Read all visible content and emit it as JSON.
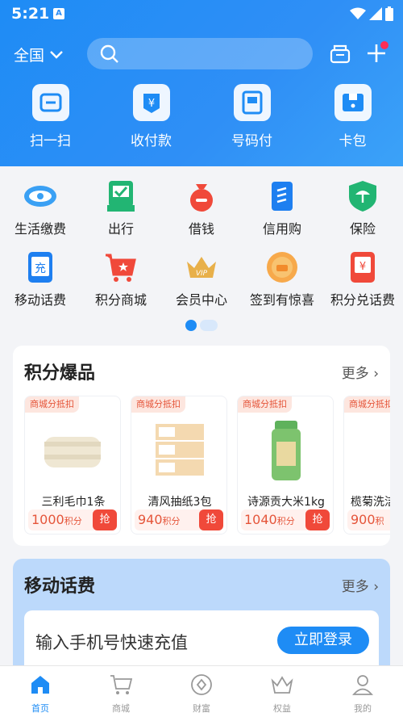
{
  "status_bar": {
    "time": "5:21",
    "notification_letter": "A"
  },
  "header": {
    "region": "全国",
    "search_placeholder": ""
  },
  "quick_actions": [
    {
      "label": "扫一扫",
      "icon": "scan-icon"
    },
    {
      "label": "收付款",
      "icon": "payment-icon"
    },
    {
      "label": "号码付",
      "icon": "phone-pay-icon"
    },
    {
      "label": "卡包",
      "icon": "card-wallet-icon"
    }
  ],
  "services": [
    {
      "label": "生活缴费",
      "icon": "utility-bill-icon"
    },
    {
      "label": "出行",
      "icon": "travel-icon"
    },
    {
      "label": "借钱",
      "icon": "loan-icon"
    },
    {
      "label": "信用购",
      "icon": "credit-shop-icon"
    },
    {
      "label": "保险",
      "icon": "insurance-icon"
    },
    {
      "label": "移动话费",
      "icon": "mobile-recharge-icon"
    },
    {
      "label": "积分商城",
      "icon": "points-mall-icon"
    },
    {
      "label": "会员中心",
      "icon": "vip-icon"
    },
    {
      "label": "签到有惊喜",
      "icon": "checkin-icon"
    },
    {
      "label": "积分兑话费",
      "icon": "points-exchange-icon"
    }
  ],
  "hot_points": {
    "title": "积分爆品",
    "more": "更多",
    "products": [
      {
        "tag": "商城分抵扣",
        "name": "三利毛巾1条",
        "points": "1000",
        "unit": "积分",
        "action": "抢"
      },
      {
        "tag": "商城分抵扣",
        "name": "清风抽纸3包",
        "points": "940",
        "unit": "积分",
        "action": "抢"
      },
      {
        "tag": "商城分抵扣",
        "name": "诗源贡大米1kg",
        "points": "1040",
        "unit": "积分",
        "action": "抢"
      },
      {
        "tag": "商城分抵扣",
        "name": "榄菊洗洁",
        "points": "900",
        "unit": "积",
        "action": ""
      }
    ]
  },
  "mobile_fee": {
    "title": "移动话费",
    "more": "更多",
    "input_prompt": "输入手机号快速充值",
    "login_button": "立即登录"
  },
  "tabs": [
    {
      "label": "首页",
      "icon": "home-icon",
      "active": true
    },
    {
      "label": "商城",
      "icon": "mall-icon",
      "active": false
    },
    {
      "label": "财富",
      "icon": "wealth-icon",
      "active": false
    },
    {
      "label": "权益",
      "icon": "rights-icon",
      "active": false
    },
    {
      "label": "我的",
      "icon": "profile-icon",
      "active": false
    }
  ],
  "colors": {
    "primary": "#1e8cf5",
    "accent_red": "#f0493a"
  }
}
